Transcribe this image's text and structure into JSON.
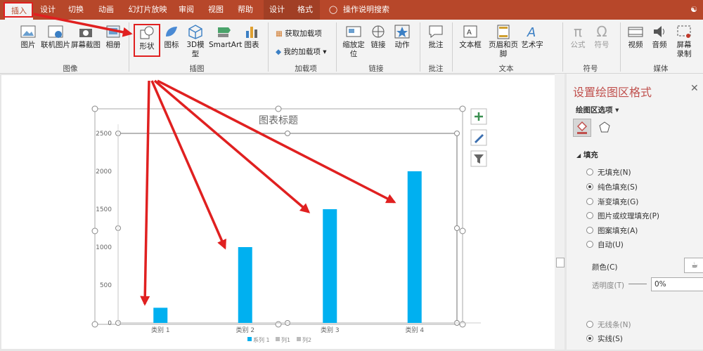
{
  "tabs": [
    "插入",
    "设计",
    "切换",
    "动画",
    "幻灯片放映",
    "审阅",
    "视图",
    "帮助",
    "设计",
    "格式"
  ],
  "tell_me": "操作说明搜索",
  "ribbon": {
    "images": [
      "图片",
      "联机图片",
      "屏幕截图",
      "相册"
    ],
    "images_group": "图像",
    "illustrations": [
      "形状",
      "图标",
      "3D模型",
      "SmartArt",
      "图表"
    ],
    "illustrations_group": "插图",
    "addins": [
      "获取加载项",
      "我的加载项"
    ],
    "addins_group": "加载项",
    "links": [
      "缩放定位",
      "链接",
      "动作"
    ],
    "links_group": "链接",
    "comments": [
      "批注"
    ],
    "comments_group": "批注",
    "text": [
      "文本框",
      "页眉和页脚",
      "艺术字"
    ],
    "text_group": "文本",
    "symbols": [
      "公式",
      "符号"
    ],
    "symbols_group": "符号",
    "media": [
      "视频",
      "音频",
      "屏幕录制"
    ],
    "media_group": "媒体"
  },
  "pane": {
    "title": "设置绘图区格式",
    "options_label": "绘图区选项",
    "section": "填充",
    "fill_options": [
      "无填充(N)",
      "纯色填充(S)",
      "渐变填充(G)",
      "图片或纹理填充(P)",
      "图案填充(A)",
      "自动(U)"
    ],
    "selected_fill": "纯色填充(S)",
    "color_label": "颜色(C)",
    "transparency_label": "透明度(T)",
    "transparency_value": "0%",
    "line_options": [
      "无线条(N)",
      "实线(S)"
    ]
  },
  "chart_data": {
    "type": "bar",
    "title": "图表标题",
    "categories": [
      "类别 1",
      "类别 2",
      "类别 3",
      "类别 4"
    ],
    "series": [
      {
        "name": "系列 1",
        "values": [
          200,
          1000,
          1500,
          2000
        ]
      }
    ],
    "legend": [
      "系列 1",
      "列1",
      "列2"
    ],
    "yticks": [
      "0",
      "500",
      "1000",
      "1500",
      "2000",
      "2500"
    ],
    "ylim": [
      0,
      2500
    ],
    "bar_color": "#00b0f0",
    "grid": false
  },
  "colors": {
    "accent": "#b7472a",
    "arrow": "#e02020"
  }
}
